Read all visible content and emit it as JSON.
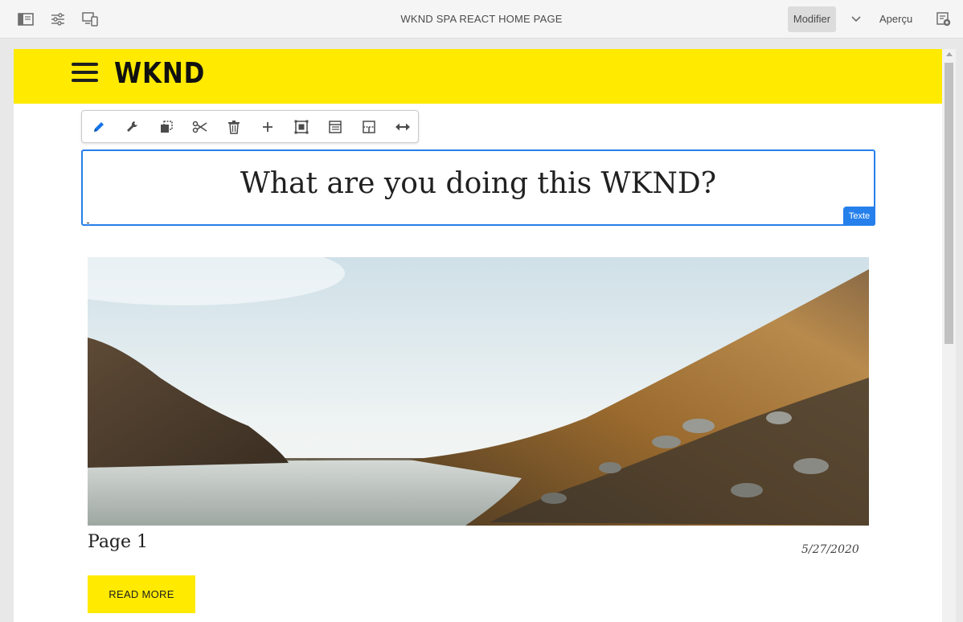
{
  "editor": {
    "page_title": "WKND SPA REACT HOME PAGE",
    "mode_label": "Modifier",
    "preview_label": "Aperçu",
    "icons": [
      "side-panel-icon",
      "page-properties-icon",
      "emulator-icon",
      "mode-chevron-icon",
      "page-info-icon"
    ]
  },
  "site": {
    "logo": "WKND",
    "header_color": "#ffea00"
  },
  "component_toolbar": {
    "actions": [
      "edit",
      "configure",
      "copy",
      "cut",
      "delete",
      "insert",
      "group",
      "parent",
      "layout",
      "resize"
    ]
  },
  "text_component": {
    "headline": "What are you doing this WKND?",
    "badge": "Texte",
    "selection_color": "#2680eb"
  },
  "teaser": {
    "title": "Page 1",
    "date": "5/27/2020",
    "button_label": "READ MORE",
    "image_description_icon": "landscape-image"
  }
}
